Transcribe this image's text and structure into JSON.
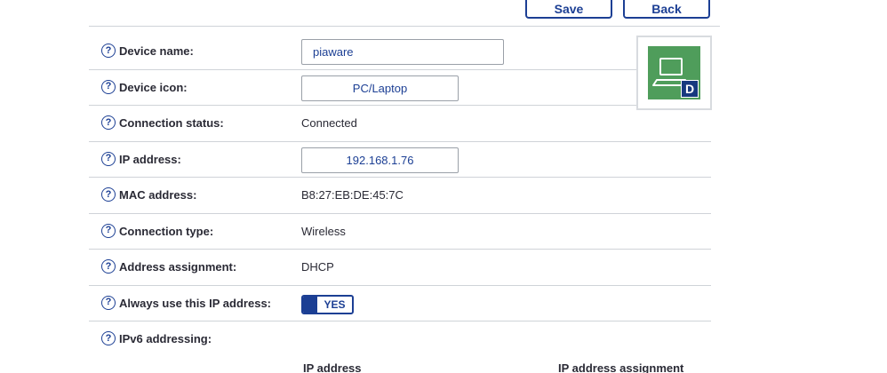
{
  "toolbar": {
    "save_label": "Save",
    "back_label": "Back"
  },
  "help_glyph": "?",
  "rows": {
    "device_name": {
      "label": "Device name:",
      "value": "piaware"
    },
    "device_icon": {
      "label": "Device icon:",
      "value": "PC/Laptop"
    },
    "connection_status": {
      "label": "Connection status:",
      "value": "Connected"
    },
    "ip_address": {
      "label": "IP address:",
      "value": "192.168.1.76"
    },
    "mac_address": {
      "label": "MAC address:",
      "value": "B8:27:EB:DE:45:7C"
    },
    "connection_type": {
      "label": "Connection type:",
      "value": "Wireless"
    },
    "address_assignment": {
      "label": "Address assignment:",
      "value": "DHCP"
    },
    "always_use_ip": {
      "label": "Always use this IP address:",
      "toggle_label": "YES"
    },
    "ipv6_addressing": {
      "label": "IPv6 addressing:"
    }
  },
  "ipv6_table": {
    "col_ip": "IP address",
    "col_assignment": "IP address assignment"
  },
  "device_card": {
    "icon": "laptop-icon",
    "badge": "D",
    "tile_color": "#4f9d5b",
    "badge_color": "#17397f"
  },
  "colors": {
    "accent": "#1c3f94",
    "divider": "#cfd3d8"
  }
}
